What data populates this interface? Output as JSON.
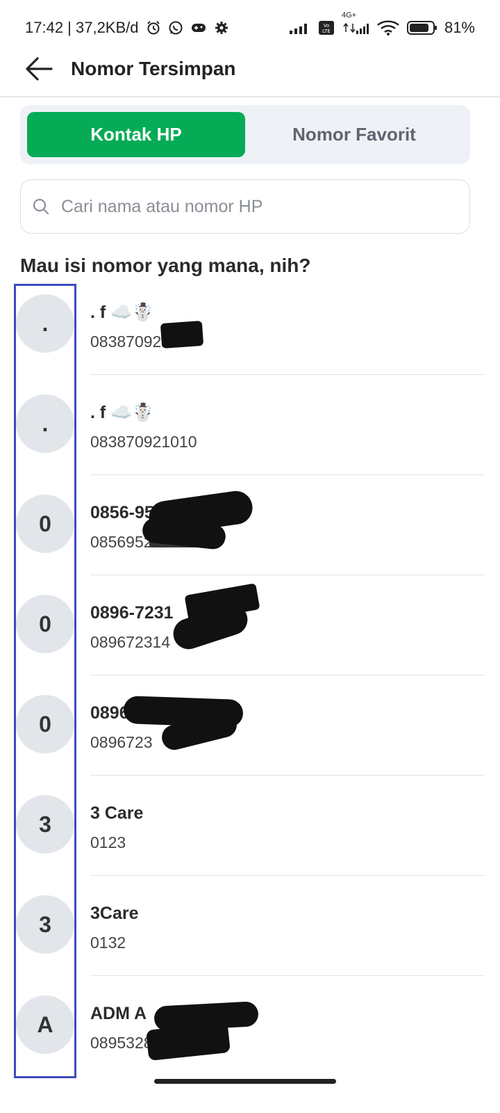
{
  "status_bar": {
    "time_data": "17:42 | 37,2KB/d",
    "network_4g": "4G+",
    "battery": "81%"
  },
  "appbar": {
    "title": "Nomor Tersimpan"
  },
  "tabs": [
    {
      "label": "Kontak HP",
      "active": true
    },
    {
      "label": "Nomor Favorit",
      "active": false
    }
  ],
  "search": {
    "placeholder": "Cari nama atau nomor HP"
  },
  "section_title": "Mau isi nomor yang mana, nih?",
  "contacts": [
    {
      "initial": ".",
      "name": ". f ☁️☃️",
      "number": "08387092",
      "redacted": true
    },
    {
      "initial": ".",
      "name": ". f ☁️☃️",
      "number": "083870921010",
      "redacted": true
    },
    {
      "initial": "0",
      "name": "0856-9527-5033",
      "number": "0856952",
      "redacted": true
    },
    {
      "initial": "0",
      "name": "0896-7231",
      "number": "089672314",
      "redacted": true
    },
    {
      "initial": "0",
      "name": "0896",
      "number": "0896723",
      "redacted": true
    },
    {
      "initial": "3",
      "name": "3 Care",
      "number": "0123",
      "redacted": false
    },
    {
      "initial": "3",
      "name": "3Care",
      "number": "0132",
      "redacted": false
    },
    {
      "initial": "A",
      "name": "ADM A",
      "number": "0895328",
      "redacted": true
    }
  ],
  "colors": {
    "accent_green": "#05ab55",
    "tab_bg": "#eef1f6",
    "avatar_bg": "#e2e5ea",
    "highlight_border": "#3e4bbd"
  }
}
